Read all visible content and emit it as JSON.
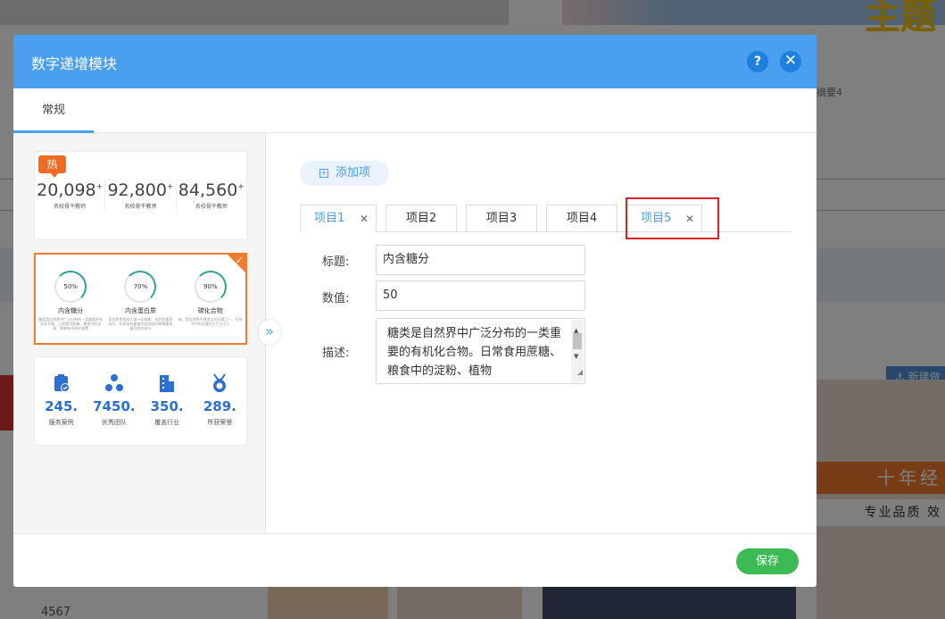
{
  "background": {
    "top_banner_text": "主题",
    "summary_text": "摘要4",
    "new_button_label": "⚓ 新建做",
    "ad_line1": "十年经",
    "ad_line2": "专业品质 效",
    "list_number": "4567"
  },
  "modal": {
    "title": "数字递增模块",
    "help_label": "?",
    "close_label": "✕",
    "tabs": [
      {
        "label": "常规"
      }
    ],
    "templates": [
      {
        "hot_label": "热",
        "stats": [
          {
            "value": "20,098",
            "suffix": "+",
            "caption": "名校骨干教师"
          },
          {
            "value": "92,800",
            "suffix": "+",
            "caption": "名校骨干教师"
          },
          {
            "value": "84,560",
            "suffix": "+",
            "caption": "名校骨干教师"
          }
        ]
      },
      {
        "selected": true,
        "rings": [
          {
            "percent": "50%",
            "title": "内含糖分",
            "desc": "糖类是自然界中广泛分布的一类重要的有机化合物。日常食用蔗糖、粮食中的淀粉、植物体中的纤维素"
          },
          {
            "percent": "70%",
            "title": "内含蛋白质",
            "desc": "蛋白质是组成人体一切细胞、组织的重要成分。机体所有重要的组成部分都需要有蛋白质的参与"
          },
          {
            "percent": "90%",
            "title": "碳化合物",
            "desc": "碳，是自然界中最常见的元素之一，在地壳中的含量约占千分之二"
          }
        ]
      },
      {
        "items": [
          {
            "icon": "clipboard-check-icon",
            "value": "245",
            "caption": "服务案例"
          },
          {
            "icon": "team-icon",
            "value": "7450",
            "caption": "优秀团队"
          },
          {
            "icon": "building-icon",
            "value": "350",
            "caption": "覆盖行业"
          },
          {
            "icon": "medal-icon",
            "value": "289",
            "caption": "所获荣誉"
          }
        ]
      }
    ],
    "collapse_label": "»",
    "add_item_label": "添加项",
    "item_tabs": [
      {
        "label": "项目1",
        "closable": true,
        "active": true
      },
      {
        "label": "项目2",
        "closable": false
      },
      {
        "label": "项目3",
        "closable": false
      },
      {
        "label": "项目4",
        "closable": false
      },
      {
        "label": "项目5",
        "closable": true
      }
    ],
    "form": {
      "title_label": "标题:",
      "title_value": "内含糖分",
      "value_label": "数值:",
      "value_value": "50",
      "desc_label": "描述:",
      "desc_value": "糖类是自然界中广泛分布的一类重要的有机化合物。日常食用蔗糖、粮食中的淀粉、植物"
    },
    "save_label": "保存",
    "accent_color": "#4a9ff0",
    "highlight_color": "#e02020"
  }
}
